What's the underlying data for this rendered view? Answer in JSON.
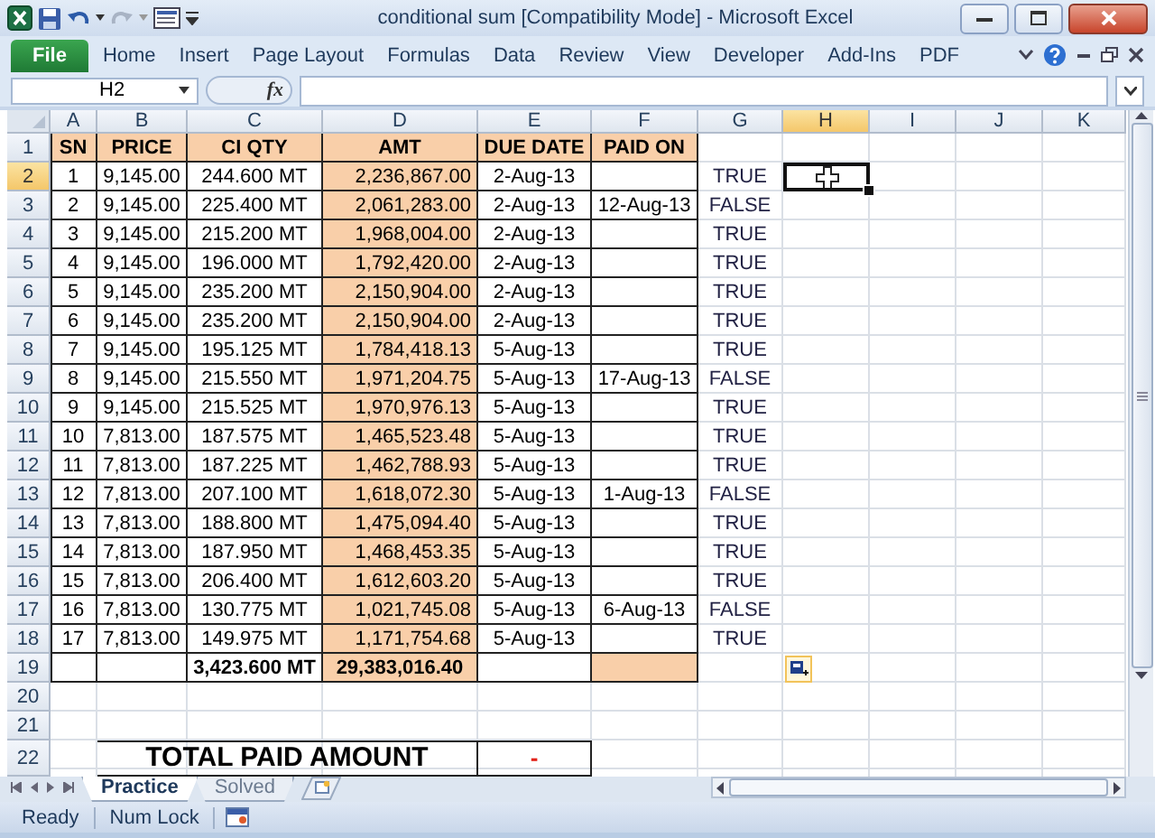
{
  "window": {
    "title": "conditional sum  [Compatibility Mode] - Microsoft Excel"
  },
  "ribbon": {
    "file_tab": "File",
    "tabs": [
      "Home",
      "Insert",
      "Page Layout",
      "Formulas",
      "Data",
      "Review",
      "View",
      "Developer",
      "Add-Ins",
      "PDF"
    ]
  },
  "formula_bar": {
    "name_box": "H2",
    "function_label": "fx"
  },
  "columns": [
    {
      "label": "A",
      "selected": false
    },
    {
      "label": "B",
      "selected": false
    },
    {
      "label": "C",
      "selected": false
    },
    {
      "label": "D",
      "selected": false
    },
    {
      "label": "E",
      "selected": false
    },
    {
      "label": "F",
      "selected": false
    },
    {
      "label": "G",
      "selected": false
    },
    {
      "label": "H",
      "selected": true
    },
    {
      "label": "I",
      "selected": false
    },
    {
      "label": "J",
      "selected": false
    },
    {
      "label": "K",
      "selected": false
    }
  ],
  "rows": [
    {
      "header": "1",
      "selected": false,
      "kind": "header",
      "cells": [
        "SN",
        "PRICE",
        "CI QTY",
        "AMT",
        "DUE DATE",
        "PAID ON"
      ]
    },
    {
      "header": "2",
      "selected": true,
      "kind": "data",
      "sn": "1",
      "price": "9,145.00",
      "qty": "244.600 MT",
      "amt": "2,236,867.00",
      "due": "2-Aug-13",
      "check": "TRUE"
    },
    {
      "header": "3",
      "selected": false,
      "kind": "data",
      "sn": "2",
      "price": "9,145.00",
      "qty": "225.400 MT",
      "amt": "2,061,283.00",
      "due": "2-Aug-13",
      "paid_on": "12-Aug-13",
      "check": "FALSE"
    },
    {
      "header": "4",
      "selected": false,
      "kind": "data",
      "sn": "3",
      "price": "9,145.00",
      "qty": "215.200 MT",
      "amt": "1,968,004.00",
      "due": "2-Aug-13",
      "check": "TRUE"
    },
    {
      "header": "5",
      "selected": false,
      "kind": "data",
      "sn": "4",
      "price": "9,145.00",
      "qty": "196.000 MT",
      "amt": "1,792,420.00",
      "due": "2-Aug-13",
      "check": "TRUE"
    },
    {
      "header": "6",
      "selected": false,
      "kind": "data",
      "sn": "5",
      "price": "9,145.00",
      "qty": "235.200 MT",
      "amt": "2,150,904.00",
      "due": "2-Aug-13",
      "check": "TRUE"
    },
    {
      "header": "7",
      "selected": false,
      "kind": "data",
      "sn": "6",
      "price": "9,145.00",
      "qty": "235.200 MT",
      "amt": "2,150,904.00",
      "due": "2-Aug-13",
      "check": "TRUE"
    },
    {
      "header": "8",
      "selected": false,
      "kind": "data",
      "sn": "7",
      "price": "9,145.00",
      "qty": "195.125 MT",
      "amt": "1,784,418.13",
      "due": "5-Aug-13",
      "check": "TRUE"
    },
    {
      "header": "9",
      "selected": false,
      "kind": "data",
      "sn": "8",
      "price": "9,145.00",
      "qty": "215.550 MT",
      "amt": "1,971,204.75",
      "due": "5-Aug-13",
      "paid_on": "17-Aug-13",
      "check": "FALSE"
    },
    {
      "header": "10",
      "selected": false,
      "kind": "data",
      "sn": "9",
      "price": "9,145.00",
      "qty": "215.525 MT",
      "amt": "1,970,976.13",
      "due": "5-Aug-13",
      "check": "TRUE"
    },
    {
      "header": "11",
      "selected": false,
      "kind": "data",
      "sn": "10",
      "price": "7,813.00",
      "qty": "187.575 MT",
      "amt": "1,465,523.48",
      "due": "5-Aug-13",
      "check": "TRUE"
    },
    {
      "header": "12",
      "selected": false,
      "kind": "data",
      "sn": "11",
      "price": "7,813.00",
      "qty": "187.225 MT",
      "amt": "1,462,788.93",
      "due": "5-Aug-13",
      "check": "TRUE"
    },
    {
      "header": "13",
      "selected": false,
      "kind": "data",
      "sn": "12",
      "price": "7,813.00",
      "qty": "207.100 MT",
      "amt": "1,618,072.30",
      "due": "5-Aug-13",
      "paid_on": "1-Aug-13",
      "check": "FALSE"
    },
    {
      "header": "14",
      "selected": false,
      "kind": "data",
      "sn": "13",
      "price": "7,813.00",
      "qty": "188.800 MT",
      "amt": "1,475,094.40",
      "due": "5-Aug-13",
      "check": "TRUE"
    },
    {
      "header": "15",
      "selected": false,
      "kind": "data",
      "sn": "14",
      "price": "7,813.00",
      "qty": "187.950 MT",
      "amt": "1,468,453.35",
      "due": "5-Aug-13",
      "check": "TRUE"
    },
    {
      "header": "16",
      "selected": false,
      "kind": "data",
      "sn": "15",
      "price": "7,813.00",
      "qty": "206.400 MT",
      "amt": "1,612,603.20",
      "due": "5-Aug-13",
      "check": "TRUE"
    },
    {
      "header": "17",
      "selected": false,
      "kind": "data",
      "sn": "16",
      "price": "7,813.00",
      "qty": "130.775 MT",
      "amt": "1,021,745.08",
      "due": "5-Aug-13",
      "paid_on": "6-Aug-13",
      "check": "FALSE"
    },
    {
      "header": "18",
      "selected": false,
      "kind": "data",
      "sn": "17",
      "price": "7,813.00",
      "qty": "149.975 MT",
      "amt": "1,171,754.68",
      "due": "5-Aug-13",
      "check": "TRUE"
    },
    {
      "header": "19",
      "selected": false,
      "kind": "total",
      "qty": "3,423.600 MT",
      "amt": "29,383,016.40"
    },
    {
      "header": "20",
      "selected": false,
      "kind": "blank"
    },
    {
      "header": "21",
      "selected": false,
      "kind": "blank"
    },
    {
      "header": "22",
      "selected": false,
      "kind": "summary",
      "label": "TOTAL PAID AMOUNT",
      "value": "-"
    }
  ],
  "sheet_tabs": [
    {
      "label": "Practice",
      "selected": true
    },
    {
      "label": "Solved",
      "selected": false
    }
  ],
  "status_bar": {
    "items": [
      "Ready",
      "Num Lock"
    ]
  }
}
